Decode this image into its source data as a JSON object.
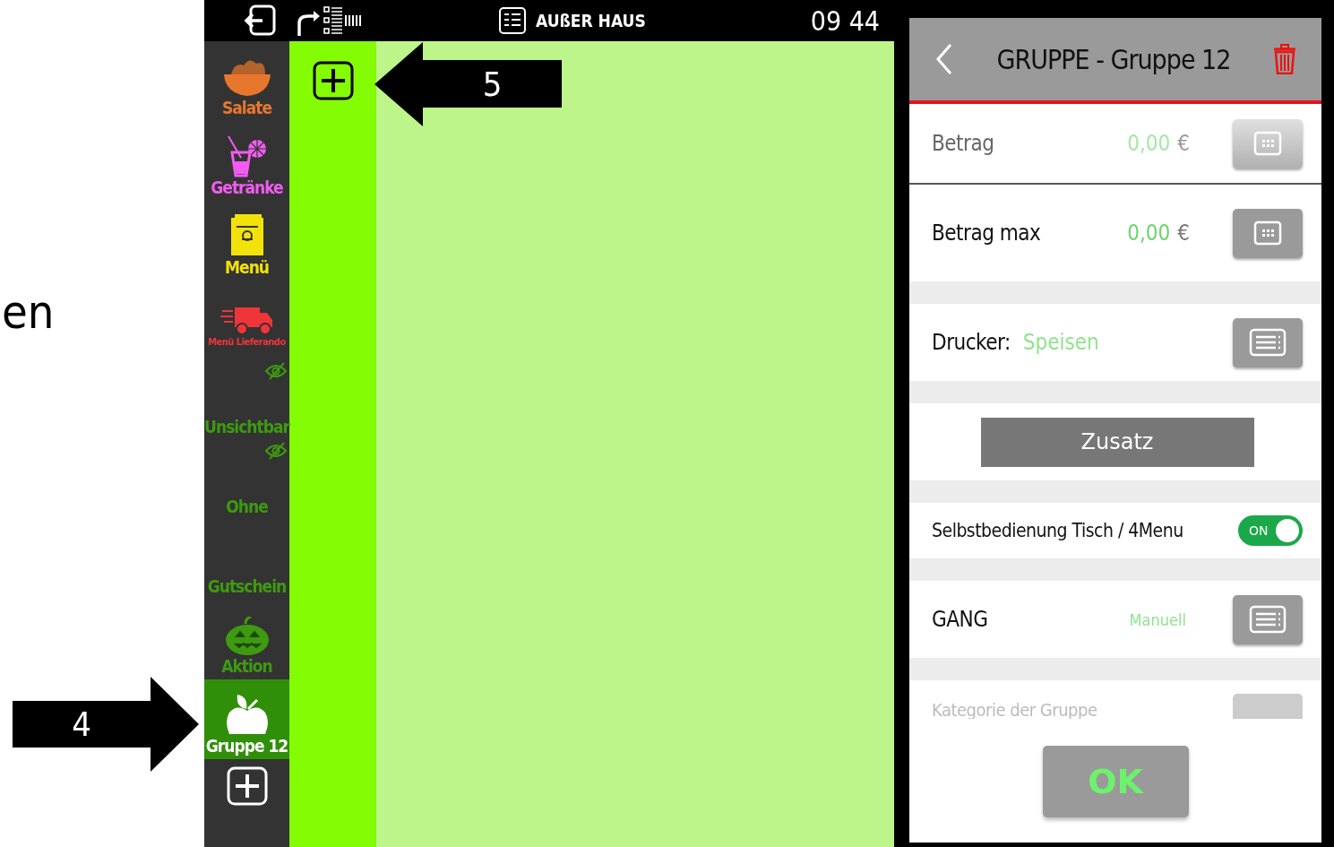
{
  "slide": {
    "fragment": "en",
    "callouts": [
      {
        "number": "4"
      },
      {
        "number": "5"
      }
    ]
  },
  "top_bar": {
    "mode": "AUßER HAUS",
    "time": "09 44"
  },
  "sidebar": {
    "items": [
      {
        "label": "Salate",
        "color": "#e8772e",
        "hidden": false,
        "selected": false,
        "small": false
      },
      {
        "label": "Getränke",
        "color": "#f25cf0",
        "hidden": false,
        "selected": false,
        "small": false
      },
      {
        "label": "Menü",
        "color": "#f2e20a",
        "hidden": false,
        "selected": false,
        "small": false
      },
      {
        "label": "Menü Lieferando",
        "color": "#f0353a",
        "hidden": false,
        "selected": false,
        "small": true
      },
      {
        "label": "Unsichtbar",
        "color": "#3e9a10",
        "hidden": true,
        "selected": false,
        "small": false
      },
      {
        "label": "Ohne",
        "color": "#3e9a10",
        "hidden": true,
        "selected": false,
        "small": false
      },
      {
        "label": "Gutschein",
        "color": "#3e9a10",
        "hidden": false,
        "selected": false,
        "small": false
      },
      {
        "label": "Aktion",
        "color": "#3e9a10",
        "hidden": false,
        "selected": false,
        "small": false
      },
      {
        "label": "Gruppe 12",
        "color": "#ffffff",
        "hidden": false,
        "selected": true,
        "small": false
      }
    ]
  },
  "dialog": {
    "title": "GRUPPE - Gruppe 12",
    "rows": [
      {
        "kind": "amount",
        "label": "Betrag",
        "value": "0,00",
        "currency": "€",
        "disabled": true
      },
      {
        "kind": "amount",
        "label": "Betrag max",
        "value": "0,00",
        "currency": "€",
        "disabled": false
      },
      {
        "kind": "printer",
        "label": "Drucker:",
        "value": "Speisen"
      },
      {
        "kind": "button",
        "label": "Zusatz"
      },
      {
        "kind": "toggle",
        "label": "Selbstbedienung Tisch / 4Menu",
        "on": true,
        "state_text": "ON"
      },
      {
        "kind": "select",
        "label": "GANG",
        "value": "Manuell"
      },
      {
        "kind": "faded",
        "label": "Kategorie der Gruppe"
      }
    ],
    "ok": "OK"
  }
}
